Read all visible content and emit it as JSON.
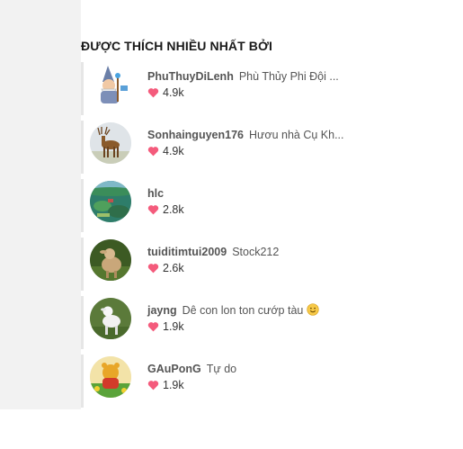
{
  "section": {
    "title": "ĐƯỢC THÍCH NHIỀU NHẤT BỞI"
  },
  "colors": {
    "heart": "#f45b7c",
    "title": "#1a1a1a",
    "username": "#555555",
    "rail": "#e6e6e6"
  },
  "users": [
    {
      "username": "PhuThuyDiLenh",
      "description": "Phù Thủy Phi Đội ...",
      "likes": "4.9k",
      "avatar_icon": "wizard-avatar"
    },
    {
      "username": "Sonhainguyen176",
      "description": "Hươu nhà Cụ Kh...",
      "likes": "4.9k",
      "avatar_icon": "deer-avatar"
    },
    {
      "username": "hlc",
      "description": "",
      "likes": "2.8k",
      "avatar_icon": "landscape-avatar"
    },
    {
      "username": "tuiditimtui2009",
      "description": "Stock212",
      "likes": "2.6k",
      "avatar_icon": "lamb-avatar"
    },
    {
      "username": "jayng",
      "description": "Dê con lon ton cướp tàu",
      "likes": "1.9k",
      "avatar_icon": "goat-avatar",
      "emoji_icon": "smiley-icon"
    },
    {
      "username": "GAuPonG",
      "description": "Tự do",
      "likes": "1.9k",
      "avatar_icon": "pooh-avatar"
    }
  ]
}
